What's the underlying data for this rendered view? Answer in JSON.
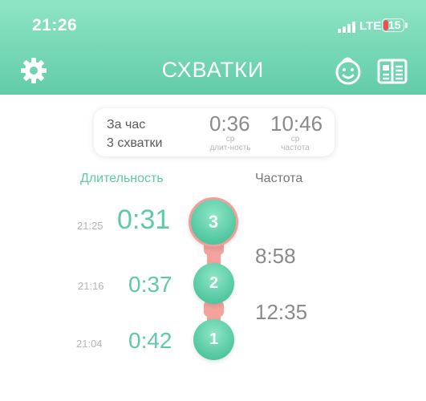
{
  "status_bar": {
    "time": "21:26",
    "network": "LTE",
    "battery": "15"
  },
  "header": {
    "title": "СХВАТКИ",
    "icons": [
      "gear-icon",
      "baby-face-icon",
      "book-icon"
    ]
  },
  "summary": {
    "period": "За час",
    "count_label": "3 схватки",
    "avg_duration": {
      "value": "0:36",
      "caption1": "ср",
      "caption2": "длит-ность"
    },
    "avg_frequency": {
      "value": "10:46",
      "caption1": "ср",
      "caption2": "частота"
    }
  },
  "columns": {
    "duration": "Длительность",
    "frequency": "Частота"
  },
  "contractions": [
    {
      "number": "3",
      "time": "21:25",
      "duration": "0:31"
    },
    {
      "number": "2",
      "time": "21:16",
      "duration": "0:37"
    },
    {
      "number": "1",
      "time": "21:04",
      "duration": "0:42"
    }
  ],
  "intervals": [
    "8:58",
    "12:35"
  ],
  "colors": {
    "accent": "#5ec9a8",
    "header_top": "#8ee5c4",
    "header_bottom": "#62cca9",
    "chain": "#f3a29c"
  }
}
